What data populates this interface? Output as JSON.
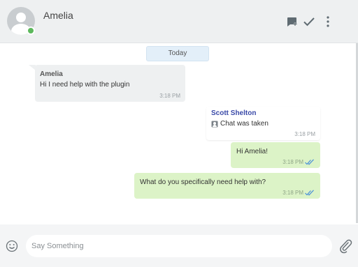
{
  "header": {
    "contact_name": "Amelia",
    "status": "online",
    "icons": [
      "new-chat-icon",
      "checkmark-icon",
      "more-vertical-icon"
    ]
  },
  "date_separator": "Today",
  "messages": [
    {
      "direction": "incoming",
      "sender": "Amelia",
      "text": "Hi I need help with the plugin",
      "time": "3:18 PM"
    },
    {
      "direction": "system",
      "sender": "Scott Shelton",
      "text": "Chat was taken",
      "icon": "agent-icon",
      "time": "3:18 PM"
    },
    {
      "direction": "outgoing",
      "text": "Hi Amelia!",
      "time": "3:18 PM",
      "read": true
    },
    {
      "direction": "outgoing",
      "text": "What do you specifically need help with?",
      "time": "3:18 PM",
      "read": true
    }
  ],
  "composer": {
    "placeholder": "Say Something",
    "value": "",
    "icons": [
      "emoji-icon",
      "paperclip-icon"
    ]
  },
  "colors": {
    "header_bg": "#eef0f1",
    "incoming_bubble": "#eef0f1",
    "outgoing_bubble": "#dcf3c7",
    "date_pill": "#e3eff9",
    "online": "#5cb85c",
    "agent_name": "#3a4aa8",
    "read_ticks": "#4a90d9"
  }
}
